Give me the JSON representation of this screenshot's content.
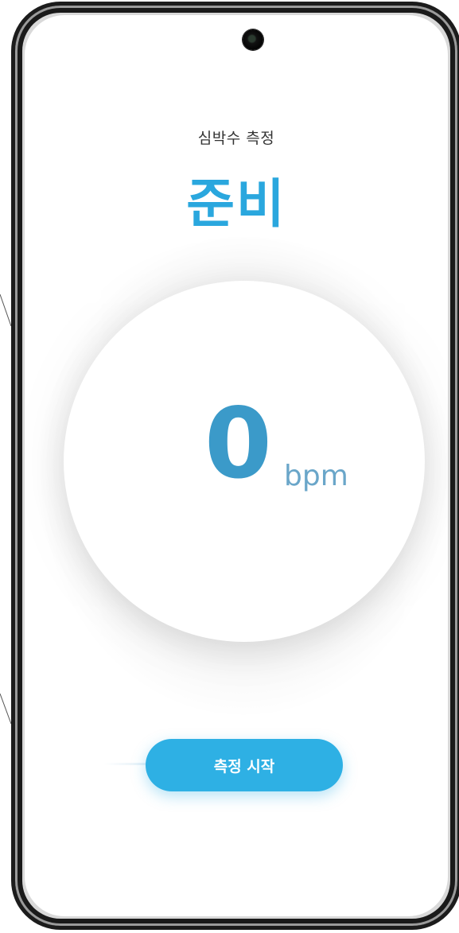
{
  "measurement": {
    "title": "심박수 측정",
    "status": "준비",
    "bpm_value": "0",
    "bpm_unit": "bpm",
    "start_button_label": "측정 시작"
  },
  "colors": {
    "accent": "#2aa7de",
    "value": "#3b9ac9",
    "unit": "#6aa6c9",
    "button": "#2eb0e4"
  },
  "icons": {
    "camera": "front-camera-icon"
  }
}
